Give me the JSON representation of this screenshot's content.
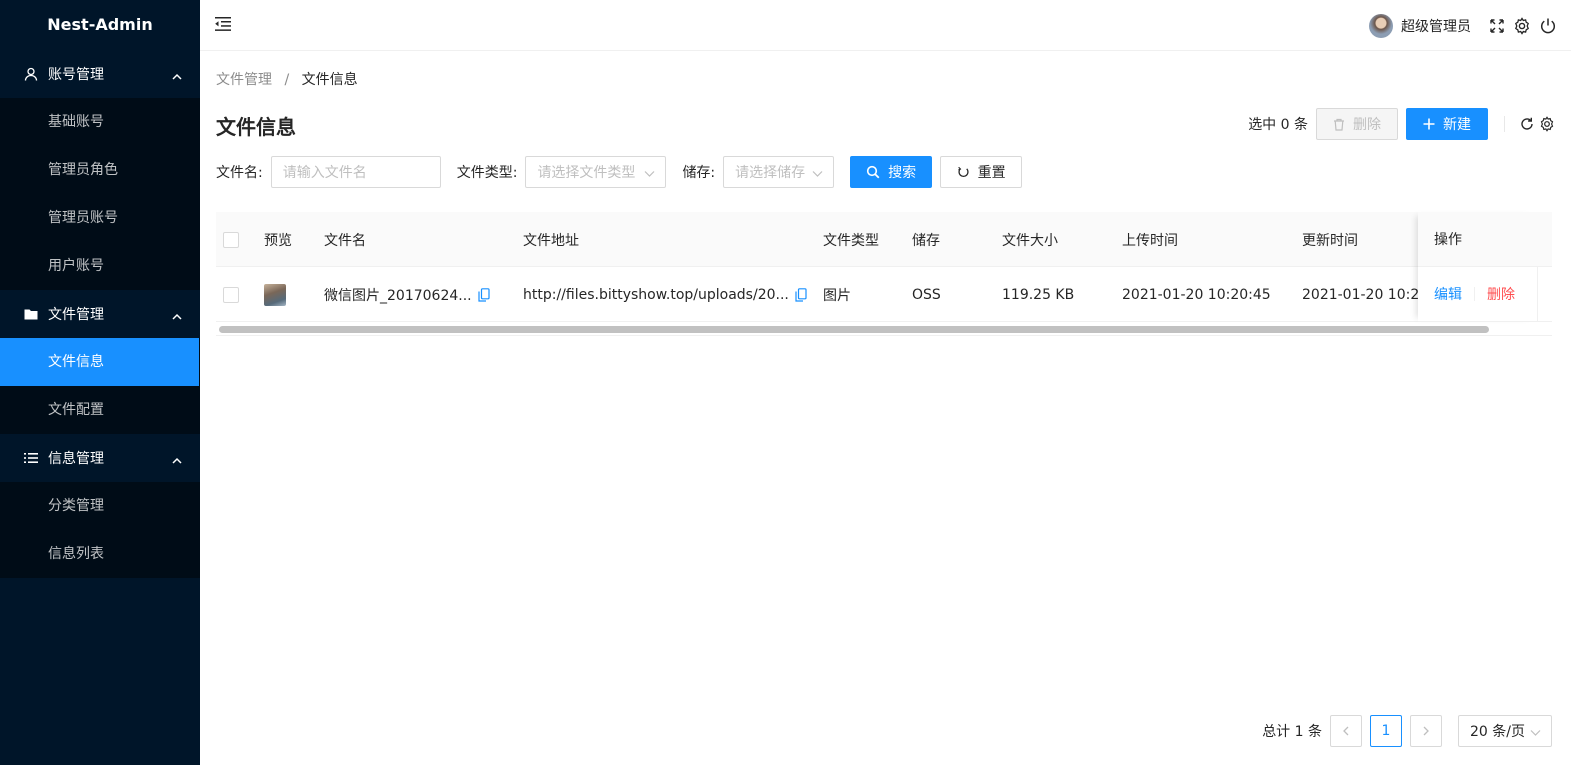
{
  "app": {
    "title": "Nest-Admin"
  },
  "sidebar": {
    "groups": [
      {
        "label": "账号管理",
        "icon": "user-icon",
        "items": [
          {
            "label": "基础账号"
          },
          {
            "label": "管理员角色"
          },
          {
            "label": "管理员账号"
          },
          {
            "label": "用户账号"
          }
        ]
      },
      {
        "label": "文件管理",
        "icon": "folder-icon",
        "items": [
          {
            "label": "文件信息",
            "active": true
          },
          {
            "label": "文件配置"
          }
        ]
      },
      {
        "label": "信息管理",
        "icon": "list-icon",
        "items": [
          {
            "label": "分类管理"
          },
          {
            "label": "信息列表"
          }
        ]
      }
    ]
  },
  "header": {
    "user_name": "超级管理员"
  },
  "breadcrumb": {
    "items": [
      "文件管理",
      "文件信息"
    ],
    "separator": "/"
  },
  "page": {
    "title": "文件信息"
  },
  "toolbar": {
    "selected_text": "选中 0 条",
    "delete_label": "删除",
    "new_label": "新建"
  },
  "filters": {
    "filename_label": "文件名:",
    "filename_placeholder": "请输入文件名",
    "filetype_label": "文件类型:",
    "filetype_placeholder": "请选择文件类型",
    "storage_label": "储存:",
    "storage_placeholder": "请选择储存",
    "search_label": "搜索",
    "reset_label": "重置"
  },
  "table": {
    "columns": [
      "预览",
      "文件名",
      "文件地址",
      "文件类型",
      "储存",
      "文件大小",
      "上传时间",
      "更新时间",
      "操作"
    ],
    "rows": [
      {
        "filename": "微信图片_20170624...",
        "url": "http://files.bittyshow.top/uploads/20...",
        "type": "图片",
        "storage": "OSS",
        "size": "119.25 KB",
        "uploaded": "2021-01-20 10:20:45",
        "updated": "2021-01-20 10:2",
        "edit_label": "编辑",
        "delete_label": "删除"
      }
    ]
  },
  "pagination": {
    "total_text": "总计 1 条",
    "current_page": "1",
    "page_size": "20 条/页"
  },
  "colors": {
    "primary": "#1890ff",
    "sidebar_bg": "#001529",
    "danger": "#ff4d4f"
  }
}
